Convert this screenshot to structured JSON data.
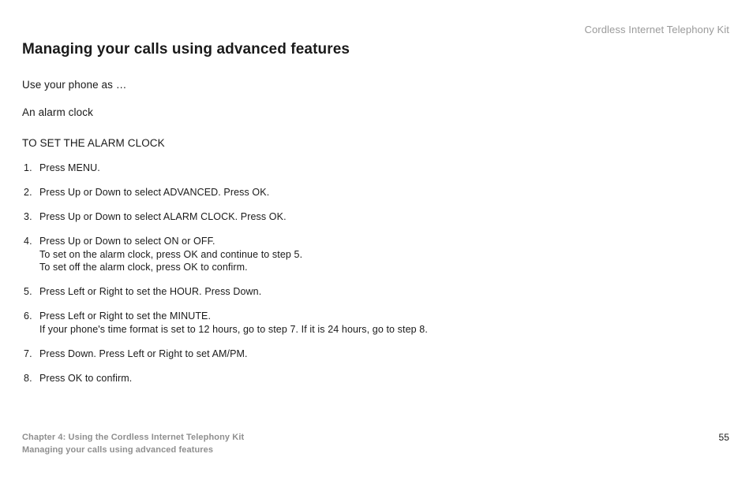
{
  "running_head": "Cordless Internet Telephony Kit",
  "title": "Managing your calls using advanced features",
  "subtitle_intro": "Use your phone as …",
  "section_name": "An alarm clock",
  "procedure_heading": "TO SET THE ALARM CLOCK",
  "steps": [
    {
      "text": "Press MENU."
    },
    {
      "text": "Press Up or Down to select ADVANCED. Press OK."
    },
    {
      "text": "Press Up or Down to select ALARM CLOCK. Press OK."
    },
    {
      "text": "Press Up or Down to select ON or OFF.",
      "extra1": "To set on the alarm clock, press OK and continue to step 5.",
      "extra2": "To set off the alarm clock, press OK to confirm."
    },
    {
      "text": "Press Left or Right to set the HOUR. Press Down."
    },
    {
      "text": "Press Left or Right to set the MINUTE.",
      "extra1": "If your phone's time format is set to 12 hours, go to step 7. If it is 24 hours, go to step 8."
    },
    {
      "text": "Press Down. Press Left or Right to set AM/PM."
    },
    {
      "text": "Press OK to confirm."
    }
  ],
  "footer": {
    "chapter_line": "Chapter 4: Using the Cordless Internet Telephony Kit",
    "section_line": "Managing your calls using advanced features",
    "page_number": "55"
  }
}
